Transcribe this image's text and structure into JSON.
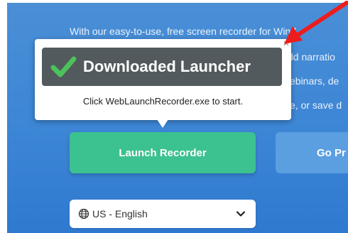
{
  "hero": {
    "line1": "With our easy-to-use, free screen recorder for Wind",
    "line2": "dd narratio",
    "line3": "ebinars, de",
    "line4": "e, or save d"
  },
  "buttons": {
    "launch_label": "Launch Recorder",
    "go_label": "Go Pr"
  },
  "language": {
    "selected": "US - English"
  },
  "popup": {
    "title": "Downloaded Launcher",
    "subtitle": "Click WebLaunchRecorder.exe to start."
  },
  "colors": {
    "background": "#3d86d6",
    "launch_button": "#3cc190",
    "go_button": "#5b9fe0",
    "banner": "#535a5d",
    "check": "#4cc25a",
    "arrow": "#ee1c1c"
  },
  "icons": {
    "check": "check-icon",
    "close": "close-icon",
    "globe": "globe-icon",
    "chevron": "chevron-down-icon",
    "arrow": "red-arrow-icon"
  }
}
